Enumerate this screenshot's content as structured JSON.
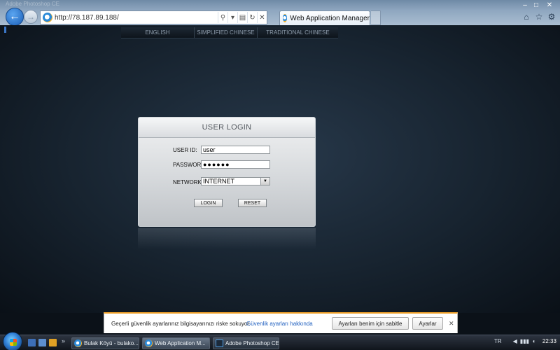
{
  "browser": {
    "ghost_title": "Adobe Photoshop CE",
    "address_url": "http://78.187.89.188/",
    "tab_title": "Web Application Manager",
    "icons": {
      "back": "back-arrow-icon",
      "forward": "forward-arrow-icon",
      "search": "search-icon",
      "compat": "compatibility-view-icon",
      "refresh": "refresh-icon",
      "stop": "stop-icon",
      "home": "home-icon",
      "favorites": "star-icon",
      "tools": "gear-icon"
    },
    "glyphs": {
      "back": "←",
      "forward": "→",
      "search": "⚲",
      "dropdown": "▾",
      "compat": "▤",
      "refresh": "↻",
      "stop": "✕",
      "minimize": "–",
      "maximize": "□",
      "close": "✕",
      "home": "⌂",
      "favorites": "☆",
      "tools": "⚙"
    }
  },
  "page": {
    "languages": [
      "ENGLISH",
      "SIMPLIFIED CHINESE",
      "TRADITIONAL CHINESE"
    ],
    "login": {
      "title": "USER LOGIN",
      "userid_label": "USER ID:",
      "userid_value": "user",
      "password_label": "PASSWORD:",
      "password_value": "●●●●●●",
      "network_label": "NETWORK:",
      "network_value": "INTERNET",
      "dropdown_glyph": "▼",
      "login_button": "LOGIN",
      "reset_button": "RESET"
    }
  },
  "security_bar": {
    "message": "Geçerli güvenlik ayarlarınız bilgisayarınızı riske sokuyor.",
    "link": "Güvenlik ayarları hakkında",
    "button_auto": "Ayarları benim için sabitle",
    "button_settings": "Ayarlar",
    "close_glyph": "✕"
  },
  "taskbar": {
    "quicklaunch_more": "»",
    "tasks": [
      {
        "label": "Bulak Köyü - bulako...",
        "icon": "internet-explorer-icon"
      },
      {
        "label": "Web Application M...",
        "icon": "internet-explorer-icon"
      },
      {
        "label": "Adobe Photoshop CE",
        "icon": "photoshop-icon"
      }
    ],
    "tray": {
      "language": "TR",
      "clock": "22:33",
      "signal_glyph": "▮▮▮",
      "arrow_glyph": "◀",
      "volume_glyph": "◖"
    }
  }
}
